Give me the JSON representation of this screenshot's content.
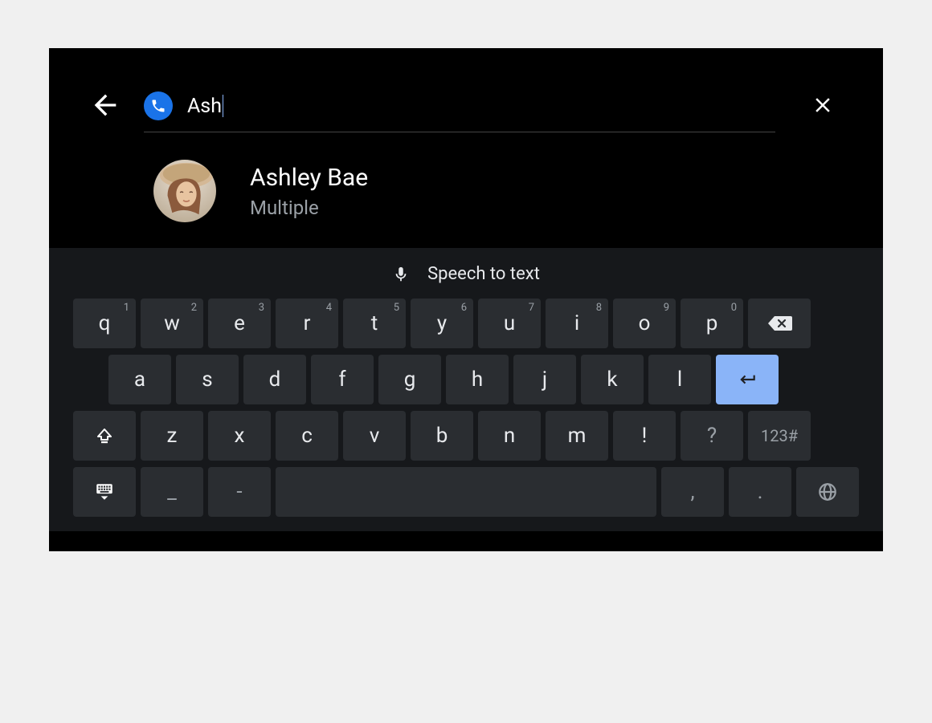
{
  "search": {
    "value": "Ash"
  },
  "result": {
    "name": "Ashley Bae",
    "subtitle": "Multiple"
  },
  "speech": {
    "label": "Speech to text"
  },
  "keyboard": {
    "row1": [
      {
        "label": "q",
        "sup": "1"
      },
      {
        "label": "w",
        "sup": "2"
      },
      {
        "label": "e",
        "sup": "3"
      },
      {
        "label": "r",
        "sup": "4"
      },
      {
        "label": "t",
        "sup": "5"
      },
      {
        "label": "y",
        "sup": "6"
      },
      {
        "label": "u",
        "sup": "7"
      },
      {
        "label": "i",
        "sup": "8"
      },
      {
        "label": "o",
        "sup": "9"
      },
      {
        "label": "p",
        "sup": "0"
      }
    ],
    "row2": [
      {
        "label": "a"
      },
      {
        "label": "s"
      },
      {
        "label": "d"
      },
      {
        "label": "f"
      },
      {
        "label": "g"
      },
      {
        "label": "h"
      },
      {
        "label": "j"
      },
      {
        "label": "k"
      },
      {
        "label": "l"
      }
    ],
    "row3": [
      {
        "label": "z"
      },
      {
        "label": "x"
      },
      {
        "label": "c"
      },
      {
        "label": "v"
      },
      {
        "label": "b"
      },
      {
        "label": "n"
      },
      {
        "label": "m"
      },
      {
        "label": "!"
      },
      {
        "label": "?"
      }
    ],
    "row4": {
      "underscore": "_",
      "dash": "-",
      "comma": ",",
      "period": "."
    },
    "sym": "123#"
  }
}
